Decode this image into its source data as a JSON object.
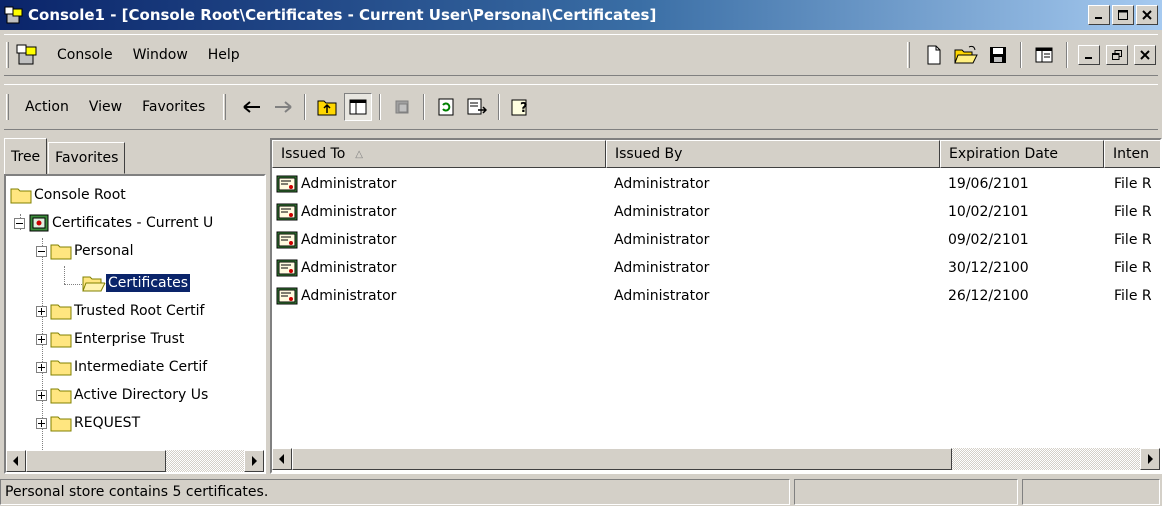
{
  "window": {
    "title": "Console1 - [Console Root\\Certificates - Current User\\Personal\\Certificates]",
    "controls": [
      "minimize-icon",
      "maximize-icon",
      "close-icon"
    ]
  },
  "menubar": {
    "items": [
      {
        "label": "Console"
      },
      {
        "label": "Window"
      },
      {
        "label": "Help"
      }
    ],
    "right_tools": [
      "new-document-icon",
      "open-folder-icon",
      "save-disk-icon",
      "show-hide-pane-icon"
    ],
    "mdi_controls": [
      "minimize-icon",
      "restore-icon",
      "close-icon"
    ]
  },
  "actionbar": {
    "items": [
      {
        "label": "Action"
      },
      {
        "label": "View"
      },
      {
        "label": "Favorites"
      }
    ],
    "tools": [
      "back-arrow-icon",
      "forward-arrow-icon",
      "up-folder-icon",
      "show-tree-icon",
      "delete-icon",
      "refresh-icon",
      "export-list-icon",
      "help-icon"
    ]
  },
  "tabs": [
    {
      "label": "Tree"
    },
    {
      "label": "Favorites"
    }
  ],
  "tree": [
    {
      "label": "Console Root"
    },
    {
      "label": "Certificates - Current U"
    },
    {
      "label": "Personal"
    },
    {
      "label": "Certificates"
    },
    {
      "label": "Trusted Root Certif"
    },
    {
      "label": "Enterprise Trust"
    },
    {
      "label": "Intermediate Certif"
    },
    {
      "label": "Active Directory Us"
    },
    {
      "label": "REQUEST"
    }
  ],
  "list": {
    "columns": [
      {
        "label": "Issued To"
      },
      {
        "label": "Issued By"
      },
      {
        "label": "Expiration Date"
      },
      {
        "label": "Inten"
      }
    ],
    "sort_indicator": "△",
    "rows": [
      [
        "Administrator",
        "Administrator",
        "19/06/2101",
        "File R"
      ],
      [
        "Administrator",
        "Administrator",
        "10/02/2101",
        "File R"
      ],
      [
        "Administrator",
        "Administrator",
        "09/02/2101",
        "File R"
      ],
      [
        "Administrator",
        "Administrator",
        "30/12/2100",
        "File R"
      ],
      [
        "Administrator",
        "Administrator",
        "26/12/2100",
        "File R"
      ]
    ]
  },
  "status": {
    "text": "Personal store contains 5 certificates."
  },
  "colors": {
    "title_active": "#0a246a",
    "face": "#d4d0c8",
    "selection": "#0a246a"
  }
}
